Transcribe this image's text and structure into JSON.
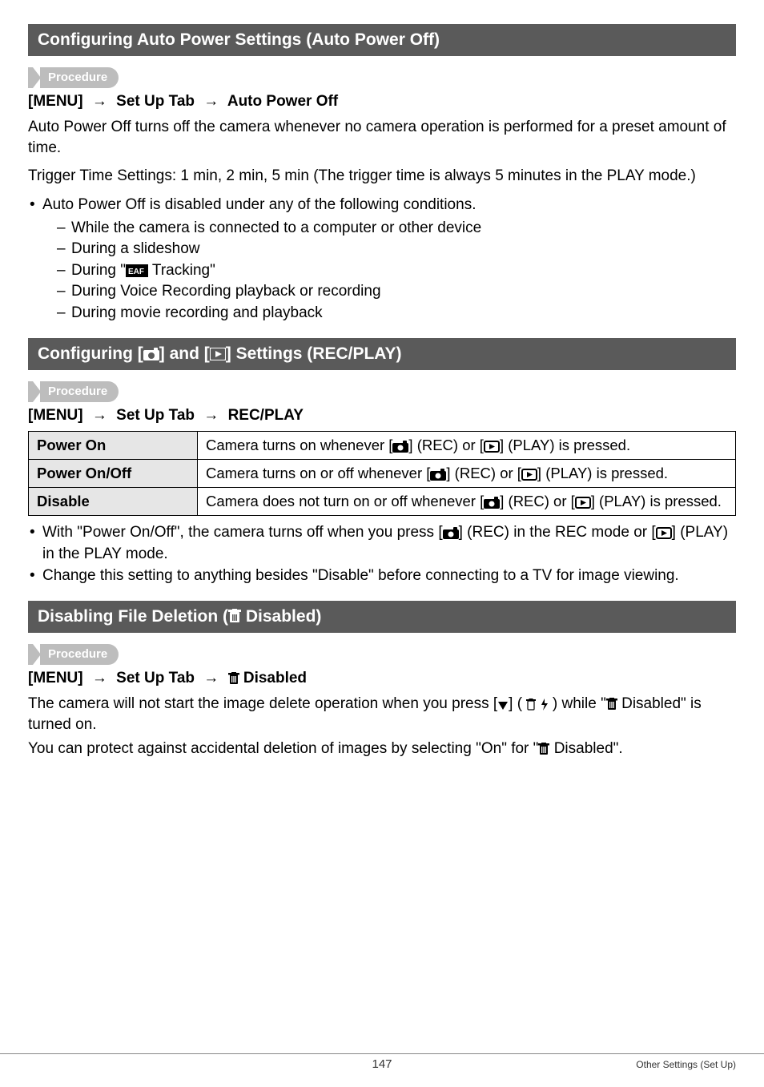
{
  "labels": {
    "procedure": "Procedure"
  },
  "section1": {
    "title": "Configuring Auto Power Settings (Auto Power Off)",
    "menu_path_prefix": "[MENU]",
    "menu_path_mid": "Set Up Tab",
    "menu_path_end": "Auto Power Off",
    "para1": "Auto Power Off turns off the camera whenever no camera operation is performed for a preset amount of time.",
    "para2": "Trigger Time Settings: 1 min, 2 min, 5 min (The trigger time is always 5 minutes in the PLAY mode.)",
    "bullet_lead": "Auto Power Off is disabled under any of the following conditions.",
    "dashes": {
      "d1": "While the camera is connected to a computer or other device",
      "d2": "During a slideshow",
      "d3_pre": "During \"",
      "d3_post": " Tracking\"",
      "d4": "During Voice Recording playback or recording",
      "d5": "During movie recording and playback"
    }
  },
  "section2": {
    "title_pre": "Configuring [",
    "title_mid": "] and [",
    "title_post": "] Settings (REC/PLAY)",
    "menu_path_prefix": "[MENU]",
    "menu_path_mid": "Set Up Tab",
    "menu_path_end": "REC/PLAY",
    "table": {
      "row1_label": "Power On",
      "row1_val_pre": "Camera turns on whenever [",
      "row1_val_mid": "] (REC) or [",
      "row1_val_post": "] (PLAY) is pressed.",
      "row2_label": "Power On/Off",
      "row2_val_pre": "Camera turns on or off whenever [",
      "row2_val_mid": "] (REC) or [",
      "row2_val_post": "] (PLAY) is pressed.",
      "row3_label": "Disable",
      "row3_val_pre": "Camera does not turn on or off whenever [",
      "row3_val_mid": "] (REC) or [",
      "row3_val_post": "] (PLAY) is pressed."
    },
    "bullets": {
      "b1_pre": "With \"Power On/Off\", the camera turns off when you press [",
      "b1_mid": "] (REC) in the REC mode or [",
      "b1_post": "] (PLAY) in the PLAY mode.",
      "b2": "Change this setting to anything besides \"Disable\" before connecting to a TV for image viewing."
    }
  },
  "section3": {
    "title_pre": "Disabling File Deletion (",
    "title_post": " Disabled)",
    "menu_path_prefix": "[MENU]",
    "menu_path_mid": "Set Up Tab",
    "menu_path_end_post": " Disabled",
    "para1_pre": "The camera will not start the image delete operation when you press [",
    "para1_mid": "] ( ",
    "para1_post": " ) while \"",
    "para1_tail": " Disabled\" is turned on.",
    "para2_pre": "You can protect against accidental deletion of images by selecting \"On\" for \"",
    "para2_post": " Disabled\"."
  },
  "footer": {
    "page": "147",
    "section": "Other Settings (Set Up)"
  }
}
